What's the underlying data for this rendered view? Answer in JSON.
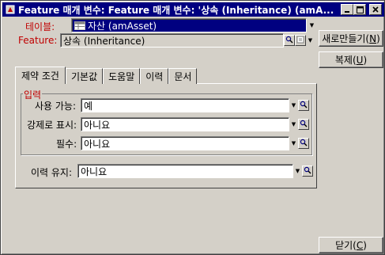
{
  "window": {
    "title": "Feature 매개 변수: Feature 매개 변수: '상속 (Inheritance) (amA...",
    "buttons": {
      "minimize": "_",
      "maximize": "□",
      "close": "×"
    }
  },
  "header": {
    "table_label": "테이블:",
    "table_value": "자산 (amAsset)",
    "feature_label": "Feature:",
    "feature_value": "상속 (Inheritance)"
  },
  "actions": {
    "new_label": "새로만들기(",
    "new_key": "N",
    "new_suffix": ")",
    "duplicate_label": "복제(",
    "duplicate_key": "U",
    "duplicate_suffix": ")",
    "close_label": "닫기(",
    "close_key": "C",
    "close_suffix": ")"
  },
  "tabs": [
    {
      "label": "제약 조건",
      "active": true
    },
    {
      "label": "기본값",
      "active": false
    },
    {
      "label": "도움말",
      "active": false
    },
    {
      "label": "이력",
      "active": false
    },
    {
      "label": "문서",
      "active": false
    }
  ],
  "input_group": {
    "legend": "입력",
    "fields": [
      {
        "label": "사용 가능:",
        "value": "예"
      },
      {
        "label": "강제로 표시:",
        "value": "아니요"
      },
      {
        "label": "필수:",
        "value": "아니요"
      }
    ]
  },
  "history": {
    "label": "이력 유지:",
    "value": "아니요"
  },
  "icons": {
    "app": "feature-app-icon",
    "table": "table-icon",
    "zoom": "magnifier-icon",
    "dropdown": "triangle-down"
  },
  "colors": {
    "titlebar": "#000080",
    "selection": "#000080",
    "label_red": "#c00000",
    "face": "#d4d0c8"
  }
}
